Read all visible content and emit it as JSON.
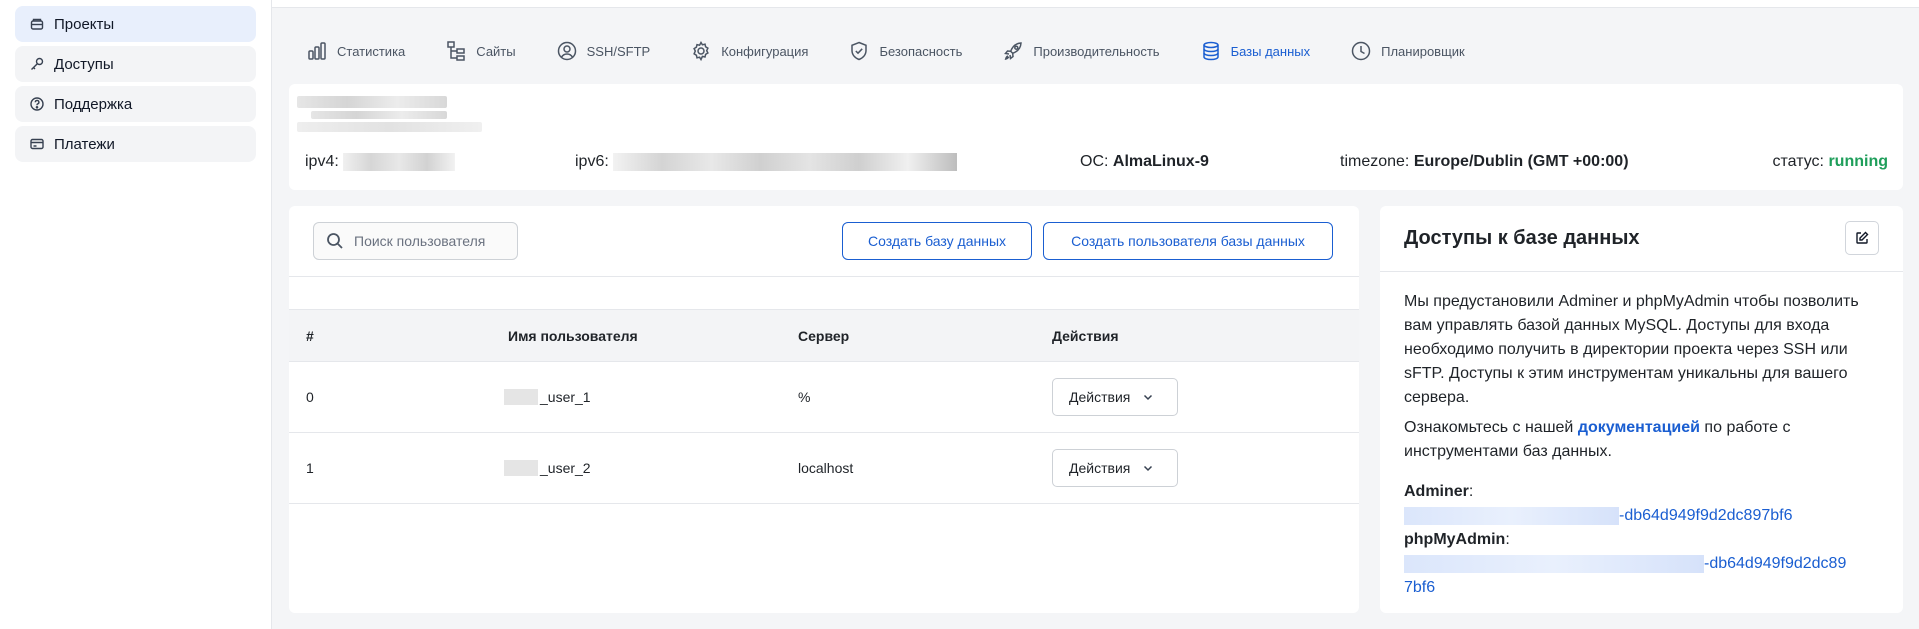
{
  "sidebar": {
    "items": [
      {
        "label": "Проекты",
        "icon": "projects-icon",
        "active": true
      },
      {
        "label": "Доступы",
        "icon": "key-icon",
        "active": false
      },
      {
        "label": "Поддержка",
        "icon": "help-icon",
        "active": false
      },
      {
        "label": "Платежи",
        "icon": "credit-card-icon",
        "active": false
      }
    ]
  },
  "tabs": [
    {
      "label": "Статистика",
      "icon": "stats-icon"
    },
    {
      "label": "Сайты",
      "icon": "sitemap-icon"
    },
    {
      "label": "SSH/SFTP",
      "icon": "user-circle-icon"
    },
    {
      "label": "Конфигурация",
      "icon": "gear-icon"
    },
    {
      "label": "Безопасность",
      "icon": "shield-icon"
    },
    {
      "label": "Производительность",
      "icon": "rocket-icon"
    },
    {
      "label": "Базы данных",
      "icon": "database-icon",
      "active": true
    },
    {
      "label": "Планировщик",
      "icon": "clock-icon"
    }
  ],
  "server": {
    "ipv4_label": "ipv4:",
    "ipv6_label": "ipv6:",
    "os_label": "ОС:",
    "os_value": "AlmaLinux-9",
    "timezone_label": "timezone:",
    "timezone_value": "Europe/Dublin (GMT +00:00)",
    "status_label": "статус:",
    "status_value": "running"
  },
  "users": {
    "search_placeholder": "Поиск пользователя",
    "create_db_label": "Создать базу данных",
    "create_user_label": "Создать пользователя базы данных",
    "columns": [
      "#",
      "Имя пользователя",
      "Сервер",
      "Действия"
    ],
    "rows": [
      {
        "num": "0",
        "user": "_user_1",
        "server": "%",
        "action": "Действия"
      },
      {
        "num": "1",
        "user": "_user_2",
        "server": "localhost",
        "action": "Действия"
      }
    ]
  },
  "db_access": {
    "title": "Доступы к базе данных",
    "paragraph1": "Мы предустановили Adminer и phpMyAdmin чтобы позволить вам управлять базой данных MySQL. Доступы для входа необходимо получить в директории проекта через SSH или sFTP. Доступы к этим инструментам уникальны для вашего сервера.",
    "paragraph2_before": "Ознакомьтесь с нашей ",
    "paragraph2_link": "документацией",
    "paragraph2_after": " по работе с инструментами баз данных.",
    "adminer_label": "Adminer",
    "adminer_url_tail": "-db64d949f9d2dc897bf6",
    "phpmyadmin_label": "phpMyAdmin",
    "phpmyadmin_url_tail": "-db64d949f9d2dc89",
    "phpmyadmin_url_tail2": "7bf6"
  },
  "colors": {
    "accent": "#1a5ed1",
    "status_running": "#1e9e5a"
  }
}
